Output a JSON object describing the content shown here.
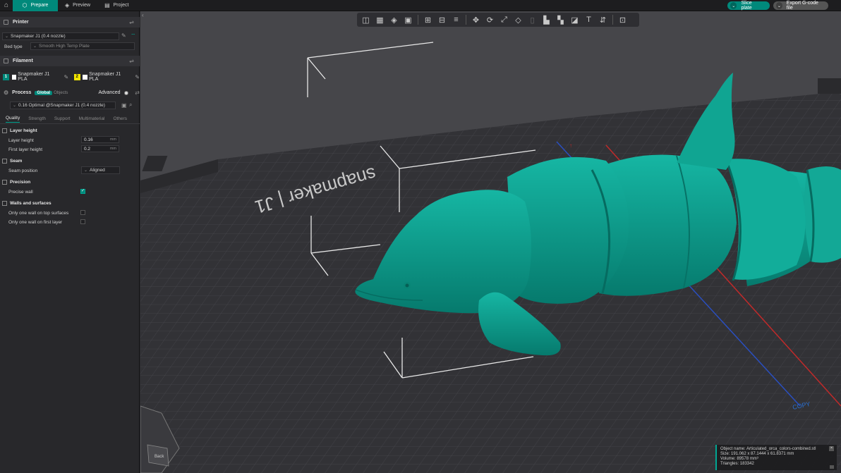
{
  "topbar": {
    "tabs": [
      {
        "label": "Prepare",
        "icon": "cube-icon"
      },
      {
        "label": "Preview",
        "icon": "layers-icon"
      },
      {
        "label": "Project",
        "icon": "document-icon"
      }
    ],
    "slice_label": "Slice plate",
    "export_label": "Export G-code file"
  },
  "sidebar": {
    "printer": {
      "title": "Printer",
      "name": "Snapmaker J1 (0.4 nozzle)",
      "bed_type_label": "Bed type",
      "bed_type_value": "Smooth High Temp Plate"
    },
    "filament": {
      "title": "Filament",
      "slots": [
        {
          "index": "1",
          "name": "Snapmaker J1 PLA",
          "color": "#00897b"
        },
        {
          "index": "2",
          "name": "Snapmaker J1 PLA",
          "color": "#f2e500"
        }
      ]
    },
    "process": {
      "title": "Process",
      "global_label": "Global",
      "objects_label": "Objects",
      "advanced_label": "Advanced",
      "preset": "0.16 Optimal @Snapmaker J1 (0.4 nozzle)"
    },
    "subtabs": [
      "Quality",
      "Strength",
      "Support",
      "Multimaterial",
      "Others"
    ],
    "groups": {
      "layer_height": {
        "title": "Layer height",
        "layer_height_label": "Layer height",
        "layer_height_value": "0.16",
        "first_layer_label": "First layer height",
        "first_layer_value": "0.2",
        "unit": "mm"
      },
      "seam": {
        "title": "Seam",
        "position_label": "Seam position",
        "position_value": "Aligned"
      },
      "precision": {
        "title": "Precision",
        "precise_wall_label": "Precise wall"
      },
      "walls": {
        "title": "Walls and surfaces",
        "top_label": "Only one wall on top surfaces",
        "first_label": "Only one wall on first layer"
      }
    }
  },
  "viewport": {
    "bed_logo": "snapmaker | J1",
    "copy_label": "COPY",
    "info": {
      "name": "Object name: Articulated_orca_colors-combined.stl",
      "size": "Size: 191.062 x 87.1444 x 61.8371 mm",
      "volume": "Volume: 89578 mm³",
      "triangles": "Triangles: 183342"
    },
    "cube_label": "Back",
    "model_color": "#0b9b8a"
  }
}
